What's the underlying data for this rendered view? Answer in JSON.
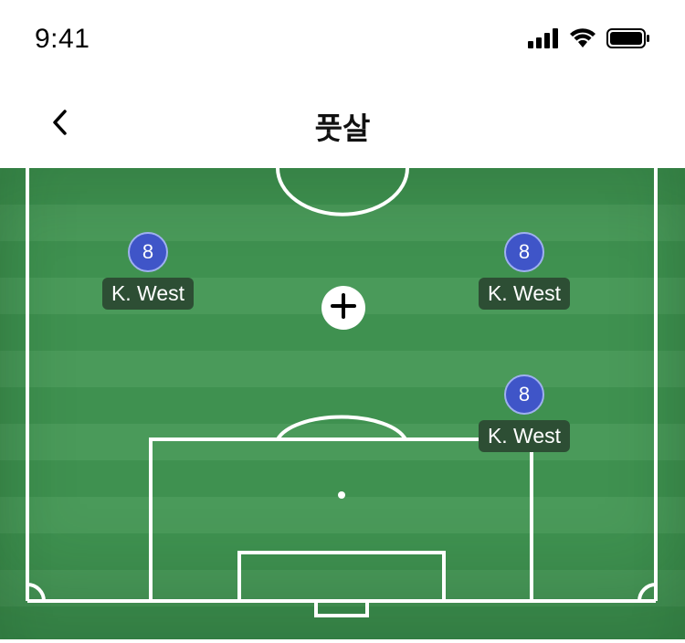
{
  "status_bar": {
    "time": "9:41",
    "icons": [
      "cellular-signal-icon",
      "wifi-icon",
      "battery-icon"
    ]
  },
  "nav": {
    "title": "풋살",
    "back_icon": "chevron-left-icon"
  },
  "pitch": {
    "colors": {
      "grass_dark": "#3f9150",
      "grass_light": "#4a9a5a",
      "line": "#ffffff"
    },
    "players": [
      {
        "number": "8",
        "name": "K. West"
      },
      {
        "number": "8",
        "name": "K. West"
      },
      {
        "number": "8",
        "name": "K. West"
      }
    ],
    "add_icon": "plus-icon",
    "jersey_color": "#3f55c8"
  }
}
